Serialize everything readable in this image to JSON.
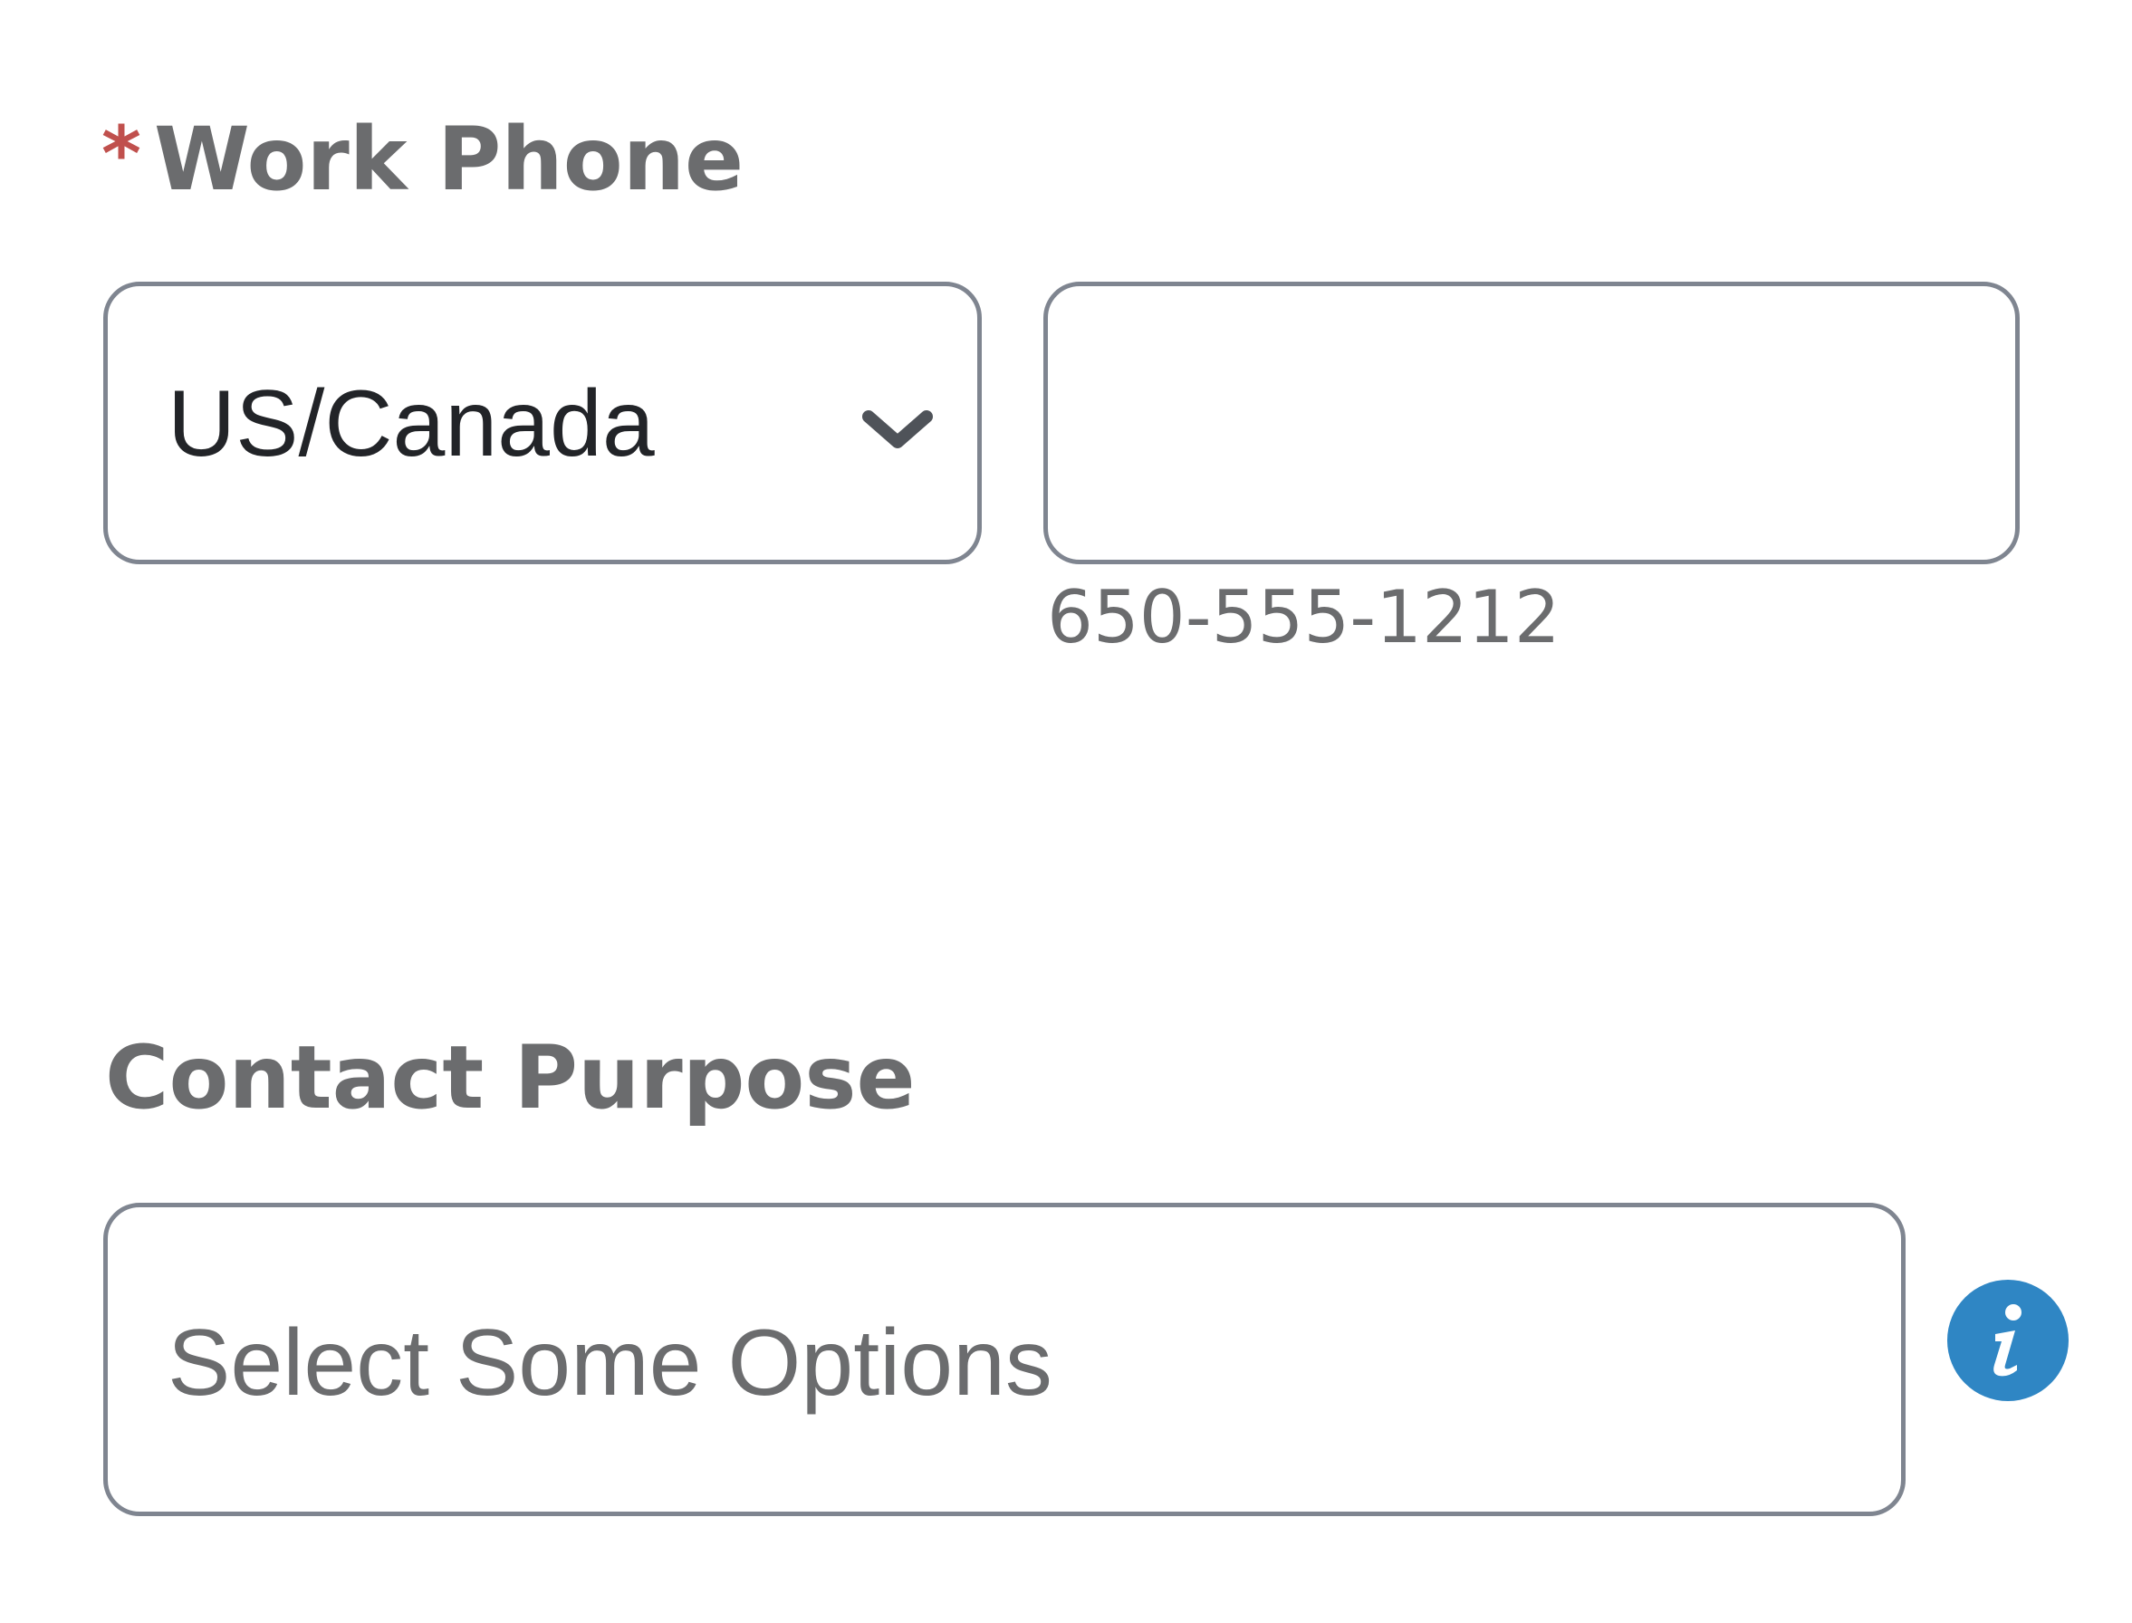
{
  "work_phone": {
    "required_marker": "*",
    "label": "Work Phone",
    "country_select": {
      "value": "US/Canada",
      "icon": "chevron-down-icon"
    },
    "phone_input": {
      "value": "",
      "hint": "650-555-1212"
    }
  },
  "contact_purpose": {
    "label": "Contact Purpose",
    "multiselect": {
      "placeholder": "Select Some Options"
    },
    "info_icon": "info-icon"
  },
  "colors": {
    "label_text": "#6b6c6e",
    "required_star": "#c0504d",
    "border": "#7f8590",
    "info_badge": "#2f86c4"
  }
}
